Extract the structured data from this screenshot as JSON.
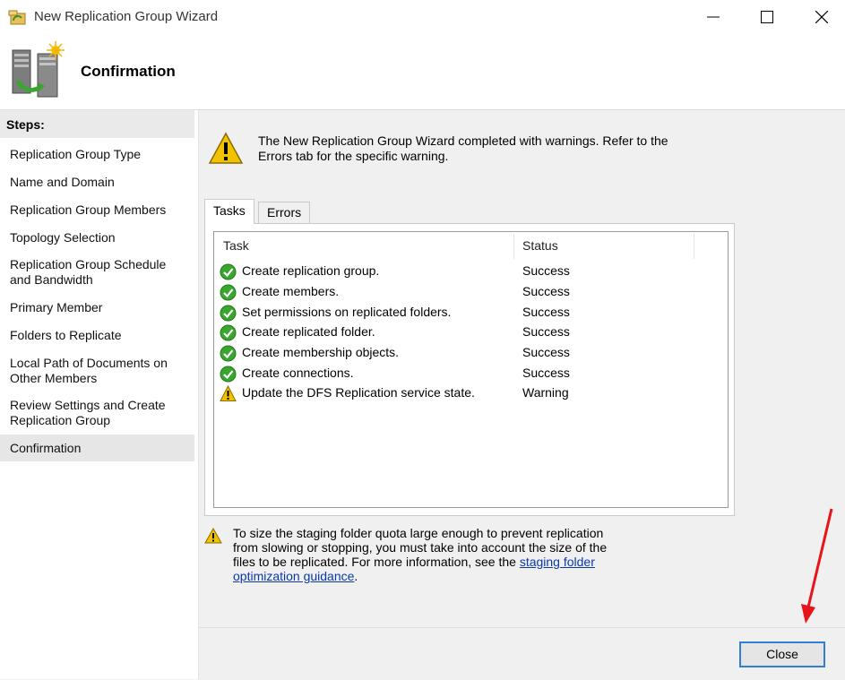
{
  "window": {
    "title": "New Replication Group Wizard"
  },
  "header": {
    "title": "Confirmation"
  },
  "steps": {
    "title": "Steps:",
    "items": [
      "Replication Group Type",
      "Name and Domain",
      "Replication Group Members",
      "Topology Selection",
      "Replication Group Schedule and Bandwidth",
      "Primary Member",
      "Folders to Replicate",
      "Local Path of Documents on Other Members",
      "Review Settings and Create Replication Group",
      "Confirmation"
    ],
    "active": "Confirmation"
  },
  "main": {
    "status_message": "The New Replication Group Wizard completed with warnings. Refer to the Errors tab for the specific warning.",
    "tabs": [
      "Tasks",
      "Errors"
    ],
    "selected_tab": "Tasks",
    "columns": [
      "Task",
      "Status"
    ],
    "rows": [
      {
        "task": "Create replication group.",
        "status": "Success",
        "icon": "success-check-icon"
      },
      {
        "task": "Create members.",
        "status": "Success",
        "icon": "success-check-icon"
      },
      {
        "task": "Set permissions on replicated folders.",
        "status": "Success",
        "icon": "success-check-icon"
      },
      {
        "task": "Create replicated folder.",
        "status": "Success",
        "icon": "success-check-icon"
      },
      {
        "task": "Create membership objects.",
        "status": "Success",
        "icon": "success-check-icon"
      },
      {
        "task": "Create connections.",
        "status": "Success",
        "icon": "success-check-icon"
      },
      {
        "task": "Update the DFS Replication service state.",
        "status": "Warning",
        "icon": "warning-icon"
      }
    ],
    "note": {
      "text": "To size the staging folder quota large enough to prevent replication from slowing or stopping, you must take into account the size of the files to be replicated. For more information, see the ",
      "link_text": "staging folder optimization guidance",
      "suffix": "."
    }
  },
  "footer": {
    "close_label": "Close"
  },
  "colors": {
    "accent": "#2f7fd6",
    "link": "#0b38a8",
    "success": "#3aa52f",
    "warning": "#f2c200",
    "annotation_arrow": "#e8141a"
  }
}
